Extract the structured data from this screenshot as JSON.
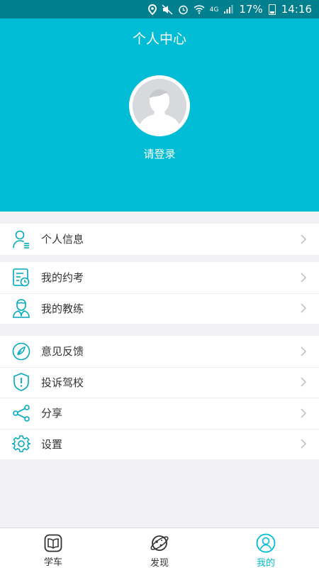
{
  "status_bar": {
    "battery": "17%",
    "time": "14:16",
    "network": "4G"
  },
  "header": {
    "title": "个人中心",
    "login_label": "请登录"
  },
  "menu_groups": [
    [
      {
        "label": "个人信息",
        "icon": "user-info-icon"
      }
    ],
    [
      {
        "label": "我的约考",
        "icon": "exam-appointment-icon"
      },
      {
        "label": "我的教练",
        "icon": "coach-icon"
      }
    ],
    [
      {
        "label": "意见反馈",
        "icon": "feedback-icon"
      },
      {
        "label": "投诉驾校",
        "icon": "complaint-icon"
      },
      {
        "label": "分享",
        "icon": "share-icon"
      },
      {
        "label": "设置",
        "icon": "settings-icon"
      }
    ]
  ],
  "tabs": [
    {
      "label": "学车",
      "icon": "book-icon"
    },
    {
      "label": "发现",
      "icon": "planet-icon"
    },
    {
      "label": "我的",
      "icon": "user-icon",
      "active": true
    }
  ],
  "colors": {
    "primary": "#00bcd4",
    "status_bar": "#007f8f",
    "icon_accent": "#00a9c0",
    "page_background": "#f2f2f4"
  }
}
